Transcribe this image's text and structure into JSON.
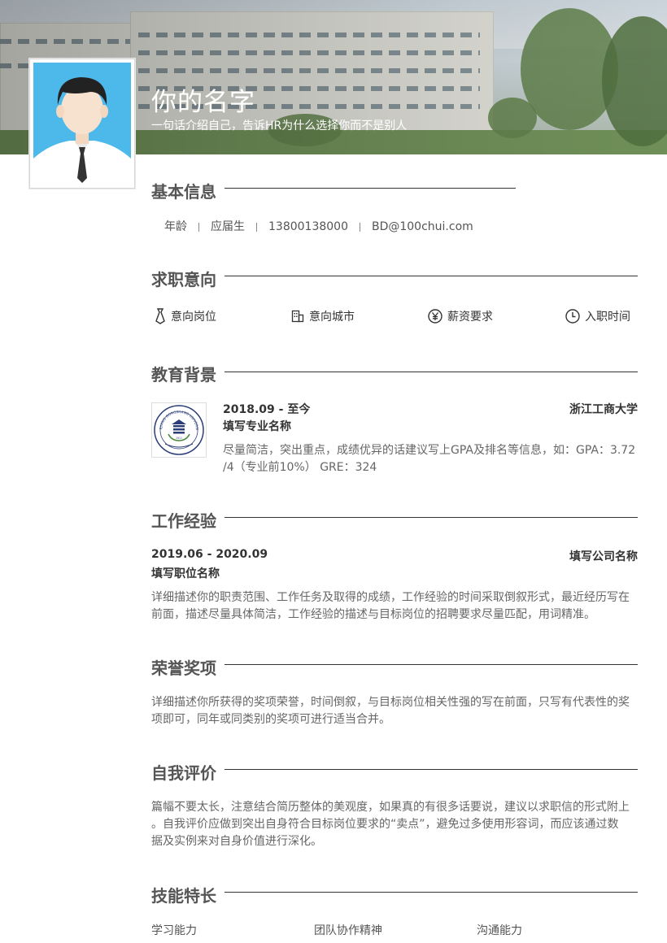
{
  "header": {
    "name": "你的名字",
    "tagline": "一句话介绍自己，告诉HR为什么选择你而不是别人"
  },
  "sections": {
    "basic": "基本信息",
    "intent": "求职意向",
    "education": "教育背景",
    "work": "工作经验",
    "honors": "荣誉奖项",
    "self": "自我评价",
    "skills": "技能特长"
  },
  "basic_info": {
    "age": "年龄",
    "status": "应届生",
    "phone": "13800138000",
    "email": "BD@100chui.com"
  },
  "intent": {
    "position": {
      "label": "意向岗位",
      "icon": "tie-icon"
    },
    "city": {
      "label": "意向城市",
      "icon": "building-icon"
    },
    "salary": {
      "label": "薪资要求",
      "icon": "yen-icon"
    },
    "entry": {
      "label": "入职时间",
      "icon": "clock-icon"
    }
  },
  "education": {
    "period": "2018.09 - 至今",
    "school": "浙江工商大学",
    "major": "填写专业名称",
    "desc_line1": "尽量简洁，突出重点，成绩优异的话建议写上GPA及排名等信息，如：GPA：3.72",
    "desc_line2": "/4（专业前10%） GRE：324",
    "logo_text": "ZHEJIANG GONGSHANG UNIVERSITY",
    "logo_year": "1911"
  },
  "work": {
    "period": "2019.06 - 2020.09",
    "company": "填写公司名称",
    "title": "填写职位名称",
    "desc_line1": "详细描述你的职责范围、工作任务及取得的成绩，工作经验的时间采取倒叙形式，最近经历写在",
    "desc_line2": "前面，描述尽量具体简洁，工作经验的描述与目标岗位的招聘要求尽量匹配，用词精准。"
  },
  "honors": {
    "line1": "详细描述你所获得的奖项荣誉，时间倒叙，与目标岗位相关性强的写在前面，只写有代表性的奖",
    "line2": "项即可，同年或同类别的奖项可进行适当合并。"
  },
  "self_eval": {
    "line1": "篇幅不要太长，注意结合简历整体的美观度，如果真的有很多话要说，建议以求职信的形式附上",
    "line2": "。自我评价应做到突出自身符合目标岗位要求的“卖点”，避免过多使用形容词，而应该通过数",
    "line3": "据及实例来对自身价值进行深化。"
  },
  "skills": [
    "学习能力",
    "团队协作精神",
    "沟通能力"
  ],
  "colors": {
    "avatar_bg": "#4db8ea",
    "title_text": "#555555",
    "rule": "#333333"
  }
}
